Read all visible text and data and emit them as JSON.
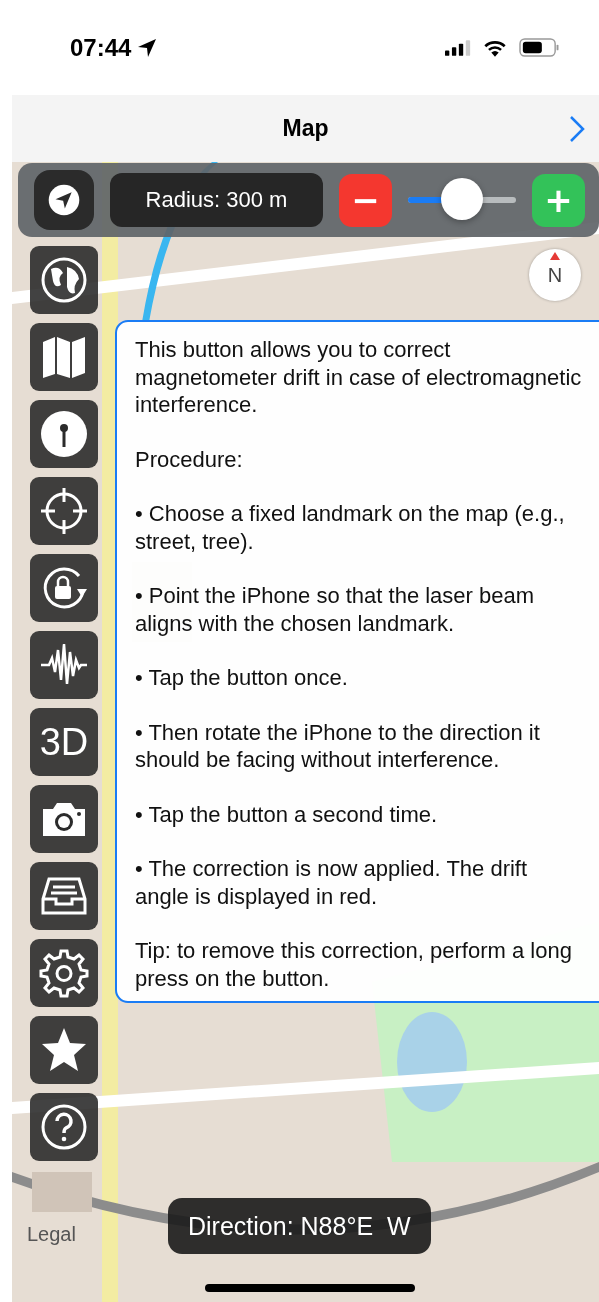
{
  "status_bar": {
    "time": "07:44"
  },
  "nav_bar": {
    "title": "Map"
  },
  "toolbar": {
    "radius": "Radius: 300 m",
    "minus": "−",
    "plus": "+",
    "slider": {
      "level": 0.5
    }
  },
  "compass": {
    "label": "N"
  },
  "sidebar": {
    "items": [
      {
        "kind": "icon"
      },
      {
        "kind": "icon"
      },
      {
        "kind": "icon"
      },
      {
        "kind": "icon"
      },
      {
        "kind": "icon"
      },
      {
        "kind": "icon"
      },
      {
        "kind": "text",
        "label": "3D"
      },
      {
        "kind": "icon"
      },
      {
        "kind": "icon"
      },
      {
        "kind": "icon"
      },
      {
        "kind": "icon"
      },
      {
        "kind": "icon"
      }
    ]
  },
  "help_popover": {
    "paragraphs": [
      "This button allows you to correct magnetometer drift in case of electromagnetic interference.",
      "Procedure:",
      "• Choose a fixed landmark on the map (e.g., street, tree).",
      "• Point the iPhone so that the laser beam aligns with the chosen landmark.",
      "• Tap the button once.",
      "• Then rotate the iPhone to the direction it should be facing without interference.",
      "• Tap the button a second time.",
      "• The correction is now applied. The drift angle is displayed in red.",
      "Tip: to remove this correction, perform a long press on the button."
    ]
  },
  "map": {
    "kind": "picture",
    "legal": "Legal"
  },
  "direction": "Direction: N88°E  W"
}
